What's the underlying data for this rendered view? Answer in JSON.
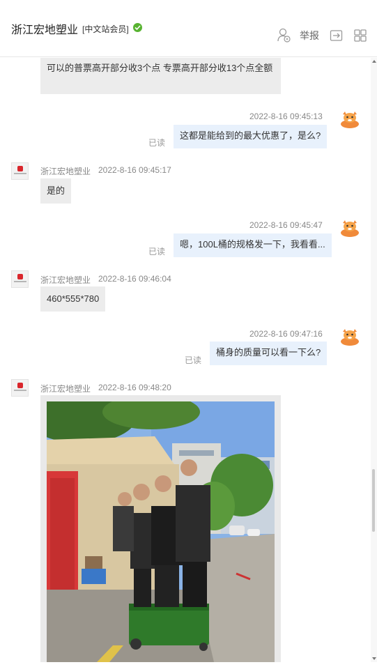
{
  "header": {
    "title": "浙江宏地塑业",
    "badge": "[中文站会员]",
    "report_label": "举报",
    "verified_color": "#58b331"
  },
  "messages": {
    "m0": {
      "text": "可以的普票高开部分收3个点  专票高开部分收13个点全额"
    },
    "m1": {
      "time": "2022-8-16 09:45:13",
      "text": "这都是能给到的最大优惠了，是么?",
      "status": "已读"
    },
    "m2": {
      "sender": "浙江宏地塑业",
      "time": "2022-8-16 09:45:17",
      "text": "是的"
    },
    "m3": {
      "time": "2022-8-16 09:45:47",
      "text": "嗯，100L桶的规格发一下，我看看...",
      "status": "已读"
    },
    "m4": {
      "sender": "浙江宏地塑业",
      "time": "2022-8-16 09:46:04",
      "text": "460*555*780"
    },
    "m5": {
      "time": "2022-8-16 09:47:16",
      "text": "桶身的质量可以看一下么?",
      "status": "已读"
    },
    "m6": {
      "sender": "浙江宏地塑业",
      "time": "2022-8-16 09:48:20",
      "image": "photo-of-workers-standing-on-green-trash-bin"
    }
  },
  "colors": {
    "bubble_left": "#ececec",
    "bubble_right": "#e8f1fc",
    "company_logo": "#d9262c",
    "user_avatar": "#f08a3a"
  }
}
